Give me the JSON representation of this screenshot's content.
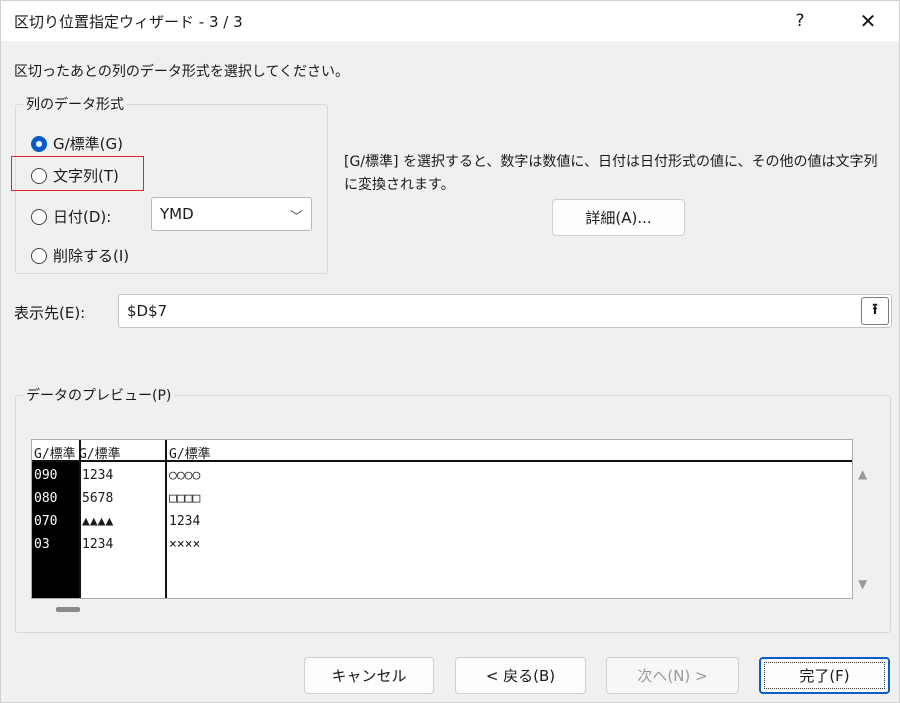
{
  "window": {
    "title": "区切り位置指定ウィザード - 3 / 3",
    "help": "?",
    "close": "✕"
  },
  "instruction": "区切ったあとの列のデータ形式を選択してください。",
  "format_group": {
    "title": "列のデータ形式",
    "options": [
      {
        "label": "G/標準(G)",
        "checked": true
      },
      {
        "label": "文字列(T)",
        "checked": false
      },
      {
        "label": "日付(D):",
        "checked": false
      },
      {
        "label": "削除する(I)",
        "checked": false
      }
    ],
    "date_select_value": "YMD"
  },
  "description": "[G/標準] を選択すると、数字は数値に、日付は日付形式の値に、その他の値は文字列に変換されます。",
  "detail_button": "詳細(A)...",
  "destination": {
    "label": "表示先(E):",
    "value": "$D$7"
  },
  "preview": {
    "title": "データのプレビュー(P)",
    "headers": [
      "G/標準",
      "G/標準",
      "G/標準"
    ],
    "rows": [
      [
        "090",
        "1234",
        "○○○○"
      ],
      [
        "080",
        "5678",
        "□□□□"
      ],
      [
        "070",
        "▲▲▲▲",
        "1234"
      ],
      [
        "03",
        "1234",
        "××××"
      ]
    ]
  },
  "buttons": {
    "cancel": "キャンセル",
    "back": "< 戻る(B)",
    "next": "次へ(N) >",
    "finish": "完了(F)"
  }
}
